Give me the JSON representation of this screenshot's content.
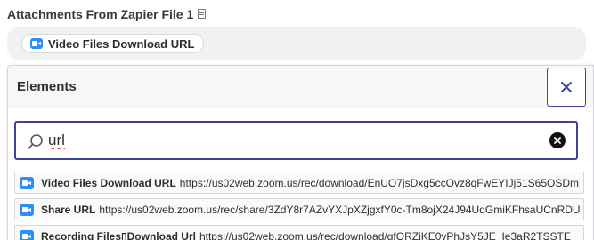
{
  "field": {
    "label": "Attachments From Zapier File 1",
    "pill_label": "Video Files Download URL"
  },
  "panel": {
    "title": "Elements",
    "search": {
      "value": "url"
    },
    "results": [
      {
        "name": "Video Files Download URL",
        "value": "https://us02web.zoom.us/rec/download/EnUO7jsDxg5ccOvz8qFwEYIJj51S65OSDm"
      },
      {
        "name": "Share URL",
        "value": "https://us02web.zoom.us/rec/share/3ZdY8r7AZvYXJpXZjgxfY0c-Tm8ojX24J94UqGmiKFhsaUCnRDU"
      },
      {
        "name": "Recording Files▯Download Url",
        "value": "https://us02web.zoom.us/rec/download/gfQRZiKE0yPhJsY5JE_Ie3aR2TSSTE"
      }
    ]
  },
  "colors": {
    "accent": "#3d4592",
    "zoom_blue": "#2d8cff",
    "field_bg": "#f0f1f3"
  },
  "icons": {
    "label_icon": "document-icon",
    "service_icon": "zoom-video-icon",
    "search_icon": "search-icon",
    "close_icon": "close-icon",
    "clear_icon": "clear-icon"
  }
}
